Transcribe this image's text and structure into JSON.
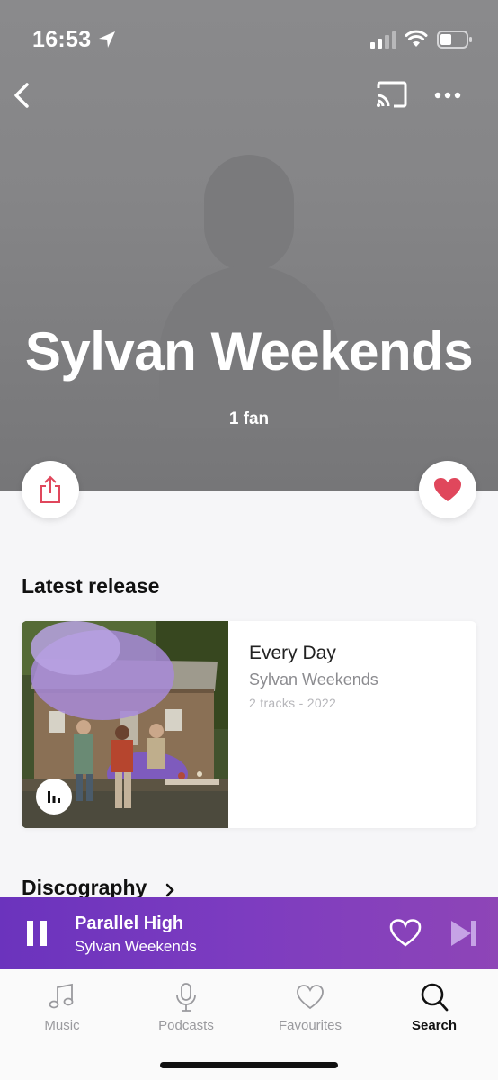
{
  "status_bar": {
    "time": "16:53",
    "icons": [
      "location-icon",
      "signal-icon",
      "wifi-icon",
      "battery-icon"
    ]
  },
  "header": {
    "icons": [
      "back-icon",
      "cast-icon",
      "more-icon"
    ]
  },
  "artist": {
    "name": "Sylvan Weekends",
    "fans": "1 fan",
    "placeholder_icon": "person-icon"
  },
  "actions": {
    "icons": [
      "share-icon",
      "heart-icon"
    ],
    "heart_color": "#e0475c"
  },
  "latest_release": {
    "section_title": "Latest release",
    "title": "Every Day",
    "artist": "Sylvan Weekends",
    "meta": "2 tracks - 2022",
    "badge_icon": "equalizer-icon"
  },
  "discography": {
    "title": "Discography",
    "icon": "chevron-right-icon"
  },
  "player": {
    "track_title": "Parallel High",
    "track_artist": "Sylvan Weekends",
    "icons": [
      "pause-icon",
      "heart-outline-icon",
      "skip-next-icon"
    ],
    "color": "#7a3ac0"
  },
  "tabs": [
    {
      "label": "Music",
      "icon": "music-note-icon",
      "active": false
    },
    {
      "label": "Podcasts",
      "icon": "microphone-icon",
      "active": false
    },
    {
      "label": "Favourites",
      "icon": "heart-outline-icon",
      "active": false
    },
    {
      "label": "Search",
      "icon": "search-icon",
      "active": true
    }
  ]
}
